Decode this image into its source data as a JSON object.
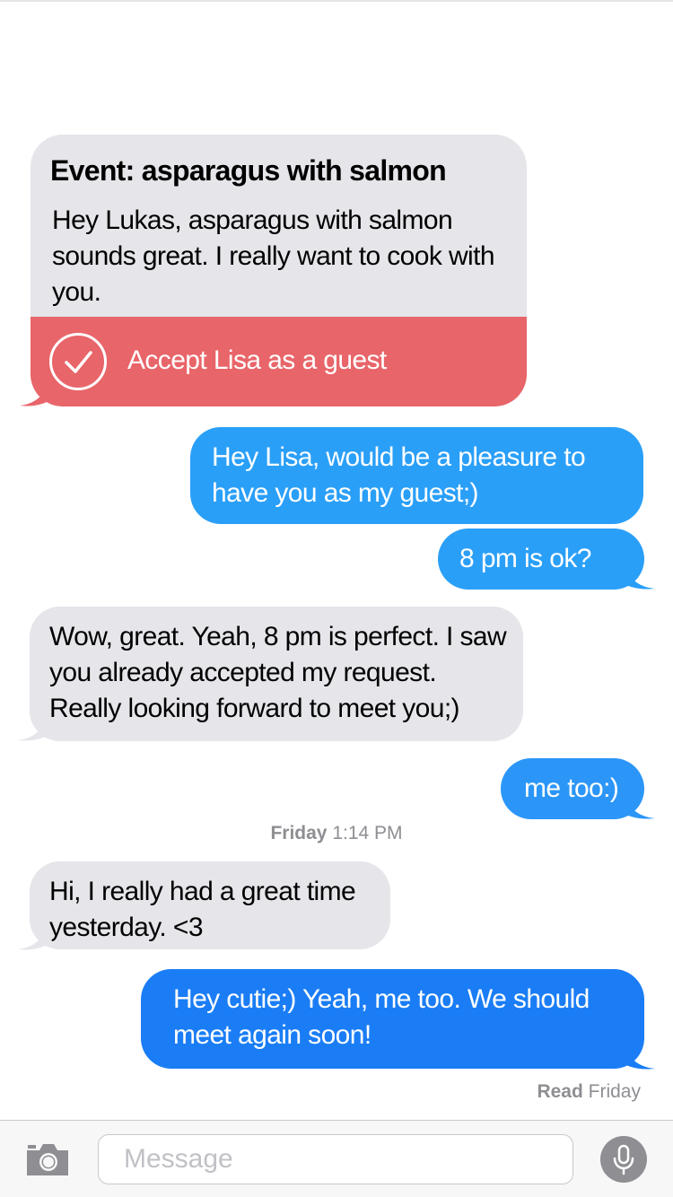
{
  "conversation": {
    "event_card": {
      "title": "Event: asparagus with salmon",
      "body": "Hey Lukas, asparagus with salmon sounds great. I really want to cook with you.",
      "accept_label": "Accept Lisa as a guest",
      "accept_icon": "checkmark-circle-icon"
    },
    "messages": [
      {
        "text_line1": "Hey Lisa, would be a pleasure to",
        "text_line2": "have you as my guest;)"
      },
      {
        "text": "8 pm is ok?"
      },
      {
        "text_line1": "Wow, great. Yeah, 8 pm is perfect. I saw",
        "text_line2": "you already accepted my request.",
        "text_line3": "Really looking forward to meet you;)"
      },
      {
        "text": "me too:)"
      },
      {
        "text_line1": "Hi, I really had a great time",
        "text_line2": "yesterday. <3"
      },
      {
        "text_line1": "Hey cutie;)  Yeah, me too. We should",
        "text_line2": "meet again soon!"
      }
    ],
    "timestamp": {
      "day": "Friday",
      "time": "1:14 PM"
    },
    "read_receipt": {
      "label": "Read",
      "when": "Friday"
    }
  },
  "input_bar": {
    "placeholder": "Message",
    "camera_icon": "camera-icon",
    "mic_icon": "microphone-icon"
  },
  "colors": {
    "incoming_bubble": "#e5e5ea",
    "outgoing_bubble": "#2a9ff8",
    "outgoing_bubble_last": "#1a7df5",
    "accept_bar": "#e86569",
    "meta_text": "#8e8e93"
  }
}
